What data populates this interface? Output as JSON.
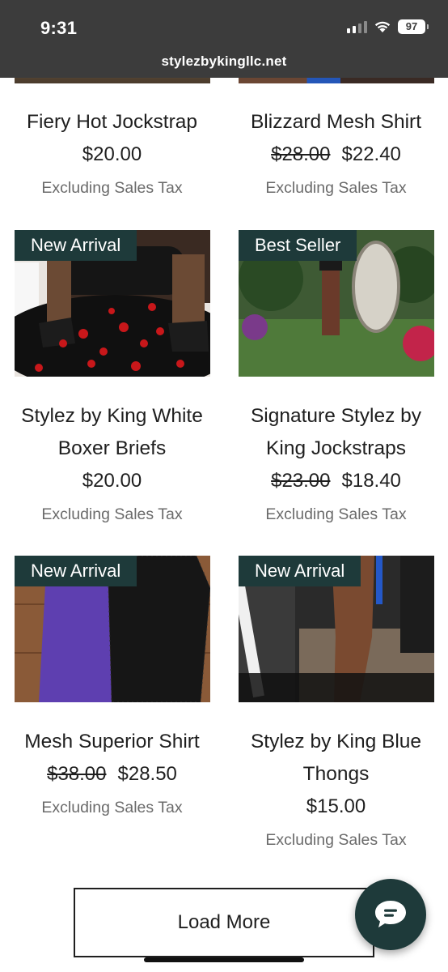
{
  "status_bar": {
    "time": "9:31",
    "battery": "97",
    "url": "stylezbykingllc.net"
  },
  "products": [
    {
      "name": "Fiery Hot Jockstrap",
      "price": "$20.00",
      "tax_note": "Excluding Sales Tax"
    },
    {
      "name": "Blizzard Mesh Shirt",
      "old_price": "$28.00",
      "price": "$22.40",
      "tax_note": "Excluding Sales Tax"
    },
    {
      "badge": "New Arrival",
      "name_line1": "Stylez by King White",
      "name_line2": "Boxer Briefs",
      "price": "$20.00",
      "tax_note": "Excluding Sales Tax"
    },
    {
      "badge": "Best Seller",
      "name_line1": "Signature Stylez by",
      "name_line2": "King Jockstraps",
      "old_price": "$23.00",
      "price": "$18.40",
      "tax_note": "Excluding Sales Tax"
    },
    {
      "badge": "New Arrival",
      "name": "Mesh Superior Shirt",
      "old_price": "$38.00",
      "price": "$28.50",
      "tax_note": "Excluding Sales Tax"
    },
    {
      "badge": "New Arrival",
      "name_line1": "Stylez by King Blue",
      "name_line2": "Thongs",
      "price": "$15.00",
      "tax_note": "Excluding Sales Tax"
    }
  ],
  "load_more_label": "Load More",
  "icons": {
    "chat": "chat-bubble-icon",
    "wifi": "wifi-icon",
    "signal": "cellular-signal-icon",
    "battery": "battery-icon"
  },
  "colors": {
    "status_bar_bg": "#3c3c3c",
    "badge_bg": "#1e3a3a",
    "chat_button_bg": "#1e3a3a"
  }
}
